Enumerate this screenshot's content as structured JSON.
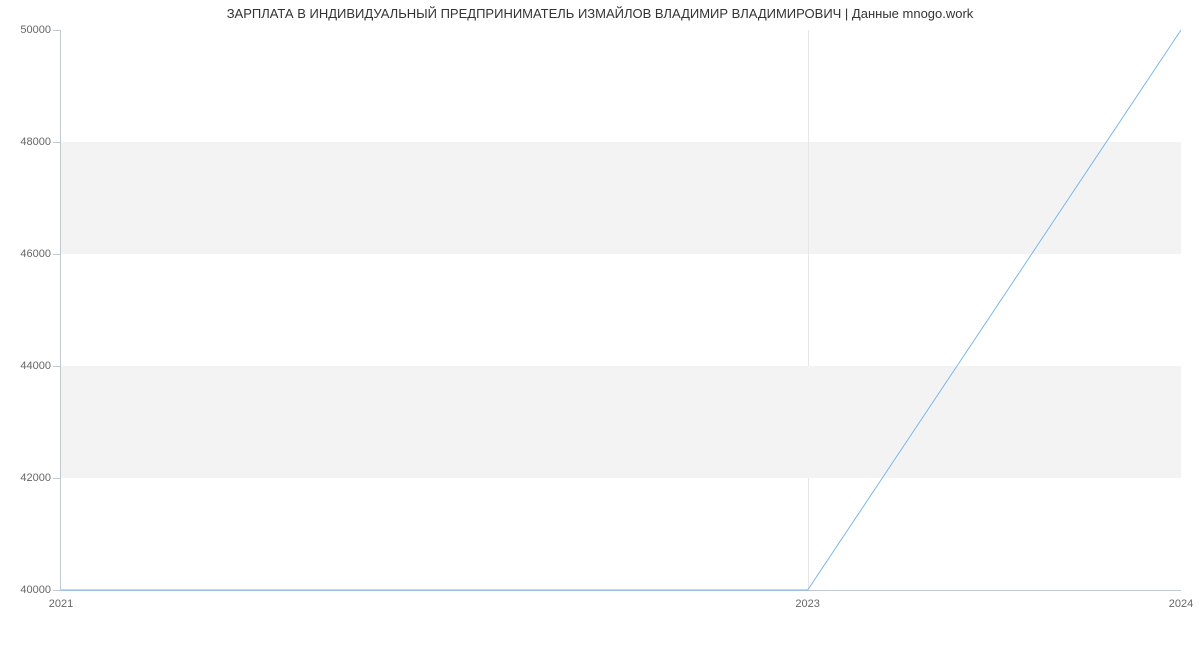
{
  "chart_data": {
    "type": "line",
    "title": "ЗАРПЛАТА В ИНДИВИДУАЛЬНЫЙ ПРЕДПРИНИМАТЕЛЬ ИЗМАЙЛОВ ВЛАДИМИР ВЛАДИМИРОВИЧ | Данные mnogo.work",
    "x": [
      2021,
      2023,
      2024
    ],
    "values": [
      40000,
      40000,
      50000
    ],
    "x_ticks": [
      2021,
      2023,
      2024
    ],
    "y_ticks": [
      40000,
      42000,
      44000,
      46000,
      48000,
      50000
    ],
    "xlim": [
      2021,
      2024
    ],
    "ylim": [
      40000,
      50000
    ],
    "xlabel": "",
    "ylabel": "",
    "line_color": "#7cb5ec"
  }
}
